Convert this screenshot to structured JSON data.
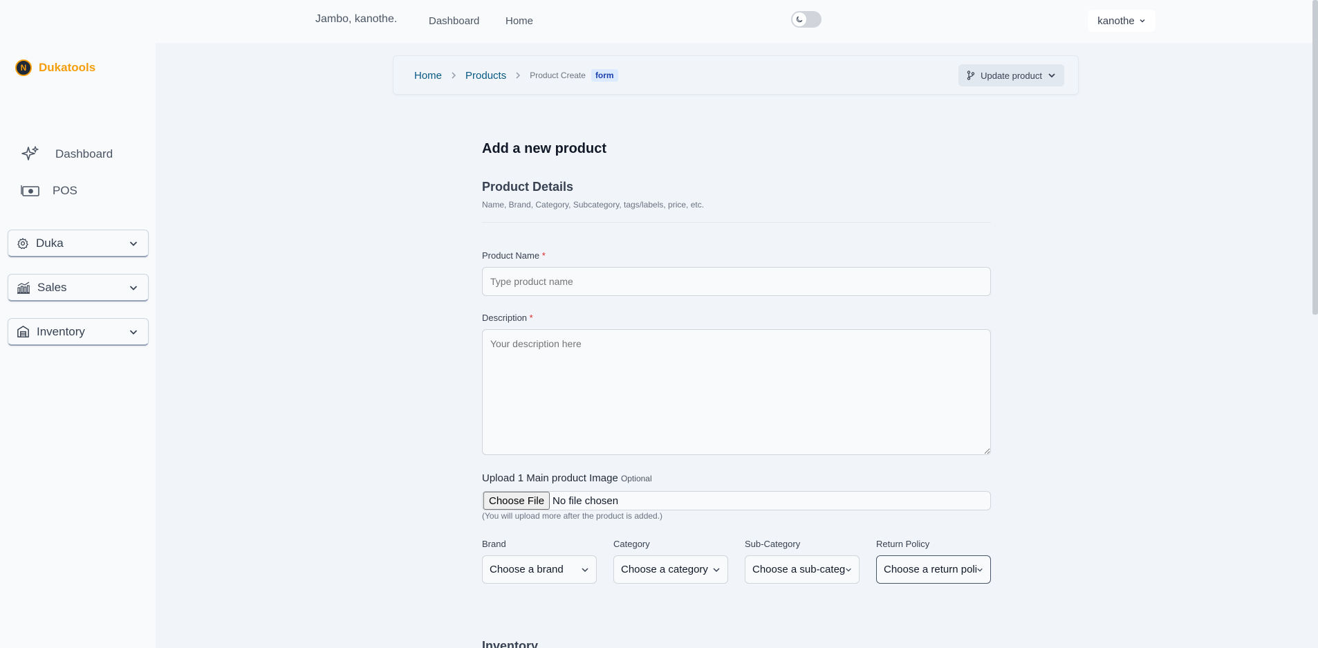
{
  "topbar": {
    "greeting": "Jambo, kanothe.",
    "links": [
      "Dashboard",
      "Home"
    ],
    "user": "kanothe"
  },
  "sidebar": {
    "brand_initial": "N",
    "brand": "Dukatools",
    "links": [
      {
        "label": "Dashboard",
        "icon": "sparkles-icon"
      },
      {
        "label": "POS",
        "icon": "cash-icon"
      }
    ],
    "groups": [
      {
        "label": "Duka",
        "icon": "gear-icon"
      },
      {
        "label": "Sales",
        "icon": "bar-chart-icon"
      },
      {
        "label": "Inventory",
        "icon": "warehouse-icon"
      }
    ]
  },
  "breadcrumb": {
    "items": [
      "Home",
      "Products"
    ],
    "current": "Product Create",
    "badge": "form",
    "action": "Update product"
  },
  "form": {
    "title": "Add a new product",
    "section": "Product Details",
    "section_sub": "Name, Brand, Category, Subcategory, tags/labels, price, etc.",
    "name_label": "Product Name",
    "name_placeholder": "Type product name",
    "desc_label": "Description",
    "desc_placeholder": "Your description here",
    "required_mark": "*",
    "upload_label": "Upload 1 Main product Image",
    "upload_optional": "Optional",
    "file_button": "Choose File",
    "file_status": "No file chosen",
    "file_hint": "(You will upload more after the product is added.)",
    "selects": [
      {
        "label": "Brand",
        "value": "Choose a brand"
      },
      {
        "label": "Category",
        "value": "Choose a category"
      },
      {
        "label": "Sub-Category",
        "value": "Choose a sub-category"
      },
      {
        "label": "Return Policy",
        "value": "Choose a return policy"
      }
    ],
    "next_section": "Inventory"
  }
}
